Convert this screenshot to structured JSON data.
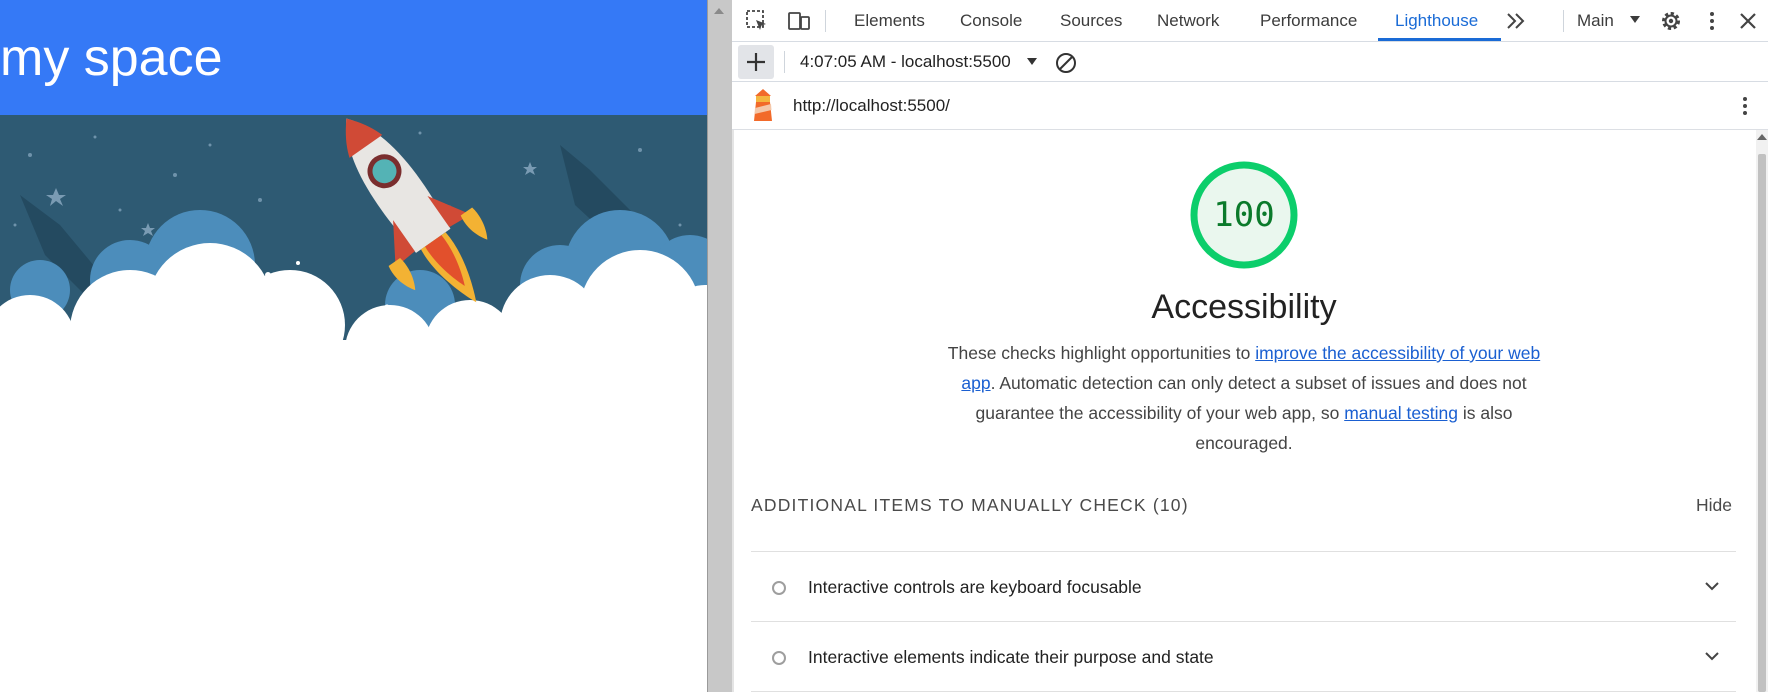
{
  "page": {
    "title": "my space"
  },
  "devtools": {
    "tabs": [
      "Elements",
      "Console",
      "Sources",
      "Network",
      "Performance",
      "Lighthouse"
    ],
    "active_tab": "Lighthouse",
    "context": "Main",
    "report_select": "4:07:05 AM - localhost:5500",
    "url": "http://localhost:5500/",
    "icons": [
      "inspect-element-icon",
      "device-toolbar-icon",
      "more-tabs-icon",
      "settings-gear-icon",
      "kebab-menu-icon",
      "close-icon",
      "add-icon",
      "clear-icon",
      "lighthouse-icon",
      "chevron-down-icon"
    ]
  },
  "report": {
    "score": "100",
    "category": "Accessibility",
    "desc_before": "These checks highlight opportunities to ",
    "desc_link1": "improve the accessibility of your web app",
    "desc_middle": ". Automatic detection can only detect a subset of issues and does not guarantee the accessibility of your web app, so ",
    "desc_link2": "manual testing",
    "desc_after": " is also encouraged.",
    "manual_heading": "ADDITIONAL ITEMS TO MANUALLY CHECK",
    "manual_count": "(10)",
    "hide_label": "Hide",
    "audits": [
      {
        "title": "Interactive controls are keyboard focusable"
      },
      {
        "title": "Interactive elements indicate their purpose and state"
      }
    ]
  },
  "colors": {
    "header_blue": "#3579f6",
    "active_tab_blue": "#1a6bd6",
    "score_green": "#0cce6b",
    "link_blue": "#1a5fd1"
  }
}
